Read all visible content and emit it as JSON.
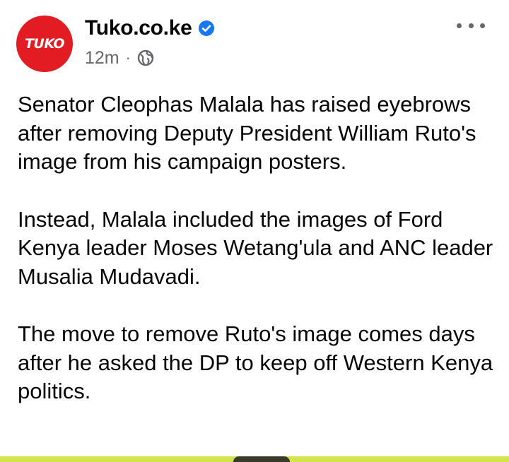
{
  "post": {
    "avatar_text": "TUKO",
    "page_name": "Tuko.co.ke",
    "time": "12m",
    "separator": "·",
    "paragraphs": [
      "Senator Cleophas Malala has raised eyebrows after removing Deputy President William Ruto's image from his campaign posters.",
      "Instead, Malala included the images of Ford Kenya leader Moses Wetang'ula and ANC leader Musalia Mudavadi.",
      "The move to remove Ruto's image comes days after he asked the DP to keep off Western Kenya politics."
    ]
  },
  "icons": {
    "verified": "verified-badge-icon",
    "audience": "globe-icon",
    "more": "more-options-icon"
  },
  "colors": {
    "brand_red": "#e31b23",
    "verified_blue": "#1877f2",
    "secondary_text": "#65676b"
  }
}
